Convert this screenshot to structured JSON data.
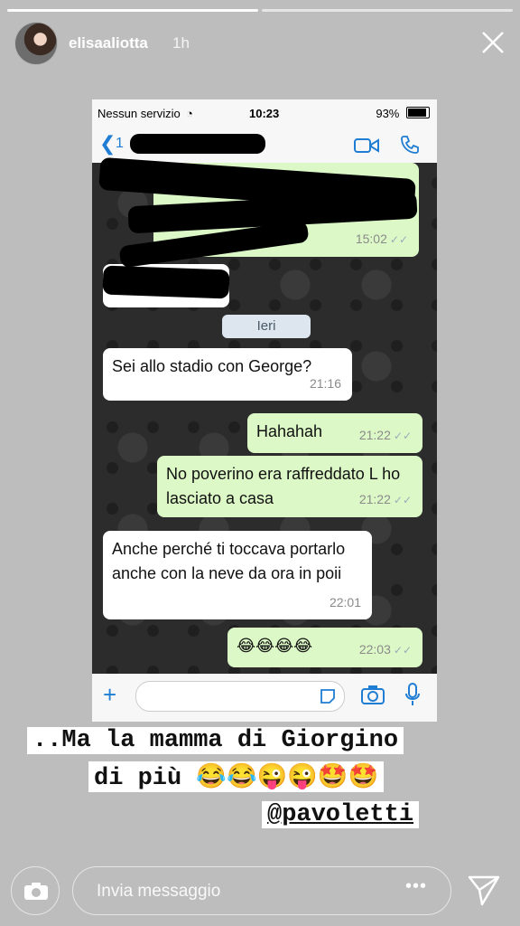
{
  "story": {
    "username": "elisaaliotta",
    "time": "1h"
  },
  "screenshot": {
    "status_left": "Nessun servizio",
    "status_time": "10:23",
    "status_battery": "93%",
    "back_label": "1",
    "date_label": "Ieri",
    "messages": [
      {
        "dir": "out",
        "text": "",
        "time": "15:02"
      },
      {
        "dir": "in",
        "text": "Sei allo stadio con George?",
        "time": "21:16"
      },
      {
        "dir": "out",
        "text": "Hahahah",
        "time": "21:22"
      },
      {
        "dir": "out",
        "text": "No poverino era raffreddato L ho lasciato a casa",
        "time": "21:22"
      },
      {
        "dir": "in",
        "text": "Anche perché ti toccava portarlo anche con la neve da ora in poii",
        "time": "22:01"
      },
      {
        "dir": "out",
        "text": "😂😂😂😂",
        "time": "22:03"
      }
    ]
  },
  "caption": {
    "line1": "..Ma la mamma di Giorgino",
    "line2": "di più 😂😂😜😜🤩🤩",
    "mention": "@pavoletti"
  },
  "reply": {
    "placeholder": "Invia messaggio",
    "more": "•••"
  },
  "colors": {
    "bubble_out": "#dcf8c6",
    "bubble_in": "#ffffff",
    "accent_blue": "#1f7dd3"
  }
}
